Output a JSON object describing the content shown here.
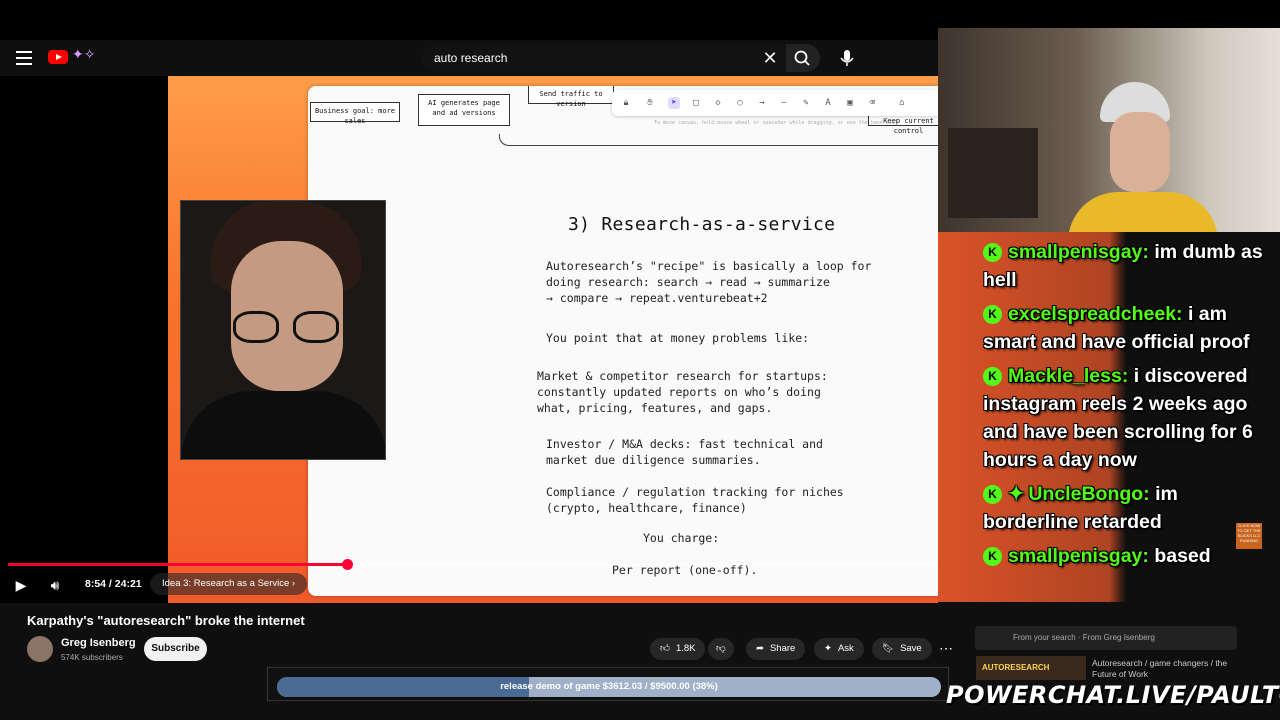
{
  "header": {
    "search_value": "auto research"
  },
  "whiteboard": {
    "flow": {
      "box1": "Business goal: more sales",
      "box2": "AI generates page and ad versions",
      "box3": "Send traffic to version",
      "box4": "Keep current control"
    },
    "toolbar_hint": "To move canvas, hold mouse wheel or spacebar while dragging, or use the hand tool",
    "title": "3) Research-as-a-service",
    "para1": "Autoresearch’s \"recipe\" is basically a loop for\ndoing research: search → read → summarize\n→ compare → repeat.venturebeat+2",
    "para2": "You point that at money problems like:",
    "para3": "Market & competitor research for startups:\nconstantly updated reports on who’s doing\nwhat, pricing, features, and gaps.",
    "para4": "Investor / M&A decks: fast technical and\nmarket due diligence summaries.",
    "para5": "Compliance / regulation tracking for niches\n(crypto, healthcare, finance)",
    "para6": "You charge:",
    "para7": "Per report (one-off)."
  },
  "player": {
    "time": "8:54 / 24:21",
    "chapter": "Idea 3: Research as a Service",
    "progress_fraction": 0.365
  },
  "video": {
    "title": "Karpathy's \"autoresearch\" broke the internet",
    "channel": "Greg Isenberg",
    "subscribers": "574K subscribers",
    "subscribe_label": "Subscribe",
    "likes": "1.8K",
    "share_label": "Share",
    "ask_label": "Ask",
    "save_label": "Save"
  },
  "donation": {
    "text": "release demo of game $3612.03 / $9500.00 (38%)",
    "fraction": 0.38
  },
  "chat": {
    "messages": [
      {
        "user": "smallpenisgay:",
        "text": "im dumb as hell"
      },
      {
        "user": "excelspreadcheek:",
        "text": "i am smart and have official proof"
      },
      {
        "user": "Mackle_less:",
        "text": "i discovered instagram reels 2 weeks ago and have been scrolling for 6 hours a day now"
      },
      {
        "user": "UncleBongo:",
        "text": "im borderline retarded"
      },
      {
        "user": "smallpenisgay:",
        "text": "based"
      }
    ]
  },
  "sidebar": {
    "notice": "From your search · From Greg Isenberg",
    "next_title": "Autoresearch / game changers / the Future of Work",
    "thumb_label": "AUTORESEARCH"
  },
  "overlay": {
    "brand": "POWERCHAT.LIVE/PAULTOWN",
    "promo": "CLICK NOW TO GET THE SLICKS LLC FUNDING"
  },
  "colors": {
    "accent_red": "#ff0033",
    "kick_green": "#53fc18",
    "slide_orange": "#f15a2b"
  }
}
